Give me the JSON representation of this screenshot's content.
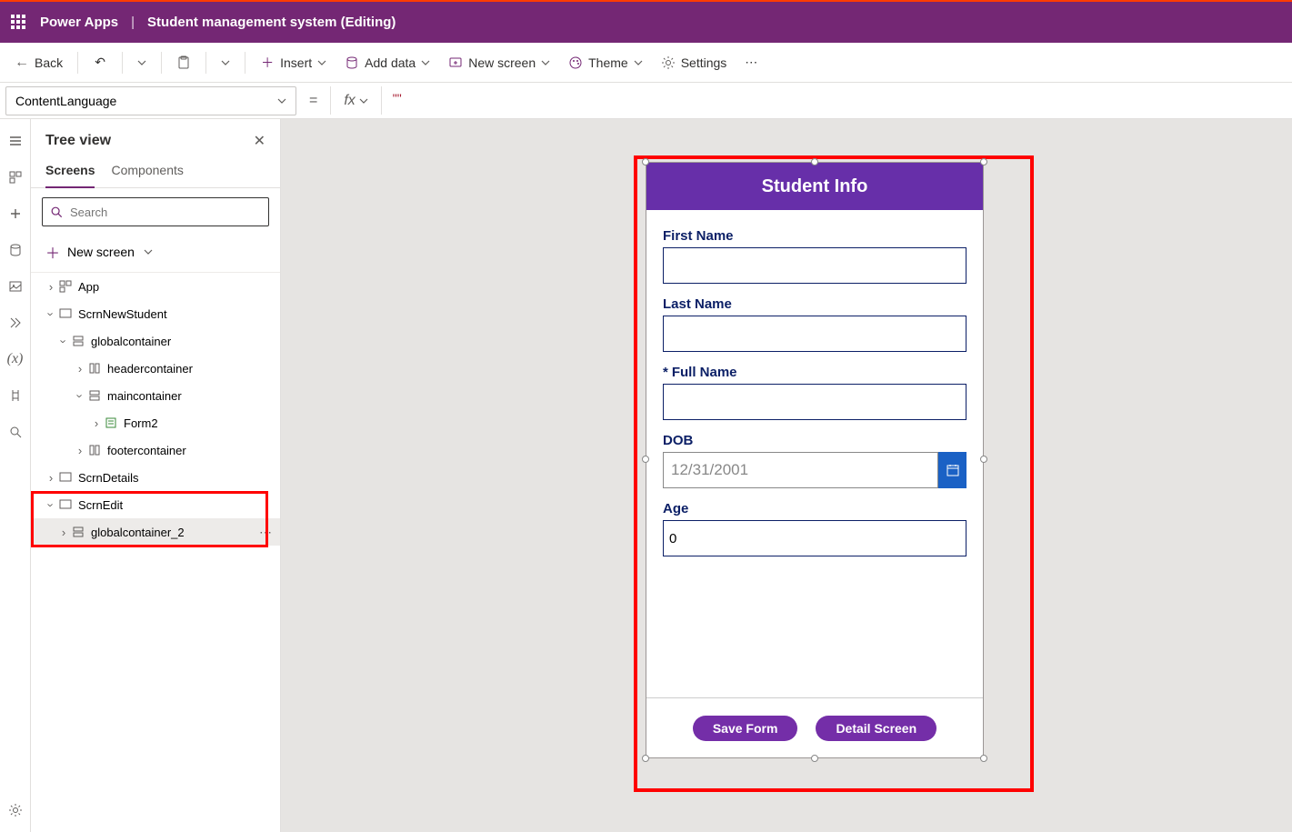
{
  "header": {
    "brand": "Power Apps",
    "divider": "|",
    "file": "Student management system (Editing)"
  },
  "commandBar": {
    "back": "Back",
    "insert": "Insert",
    "addData": "Add data",
    "newScreen": "New screen",
    "theme": "Theme",
    "settings": "Settings"
  },
  "formulaBar": {
    "property": "ContentLanguage",
    "equals": "=",
    "fx": "fx",
    "value": "\"\""
  },
  "tree": {
    "title": "Tree view",
    "tabs": {
      "screens": "Screens",
      "components": "Components"
    },
    "searchPlaceholder": "Search",
    "newScreen": "New screen",
    "nodes": {
      "app": "App",
      "scrnNewStudent": "ScrnNewStudent",
      "globalcontainer": "globalcontainer",
      "headercontainer": "headercontainer",
      "maincontainer": "maincontainer",
      "form2": "Form2",
      "footercontainer": "footercontainer",
      "scrnDetails": "ScrnDetails",
      "scrnEdit": "ScrnEdit",
      "globalcontainer2": "globalcontainer_2"
    }
  },
  "canvas": {
    "title": "Student Info",
    "labels": {
      "firstName": "First Name",
      "lastName": "Last Name",
      "fullName": "Full Name",
      "dob": "DOB",
      "age": "Age"
    },
    "values": {
      "firstName": "",
      "lastName": "",
      "fullName": "",
      "dob": "12/31/2001",
      "age": "0"
    },
    "buttons": {
      "save": "Save Form",
      "detail": "Detail Screen"
    }
  }
}
